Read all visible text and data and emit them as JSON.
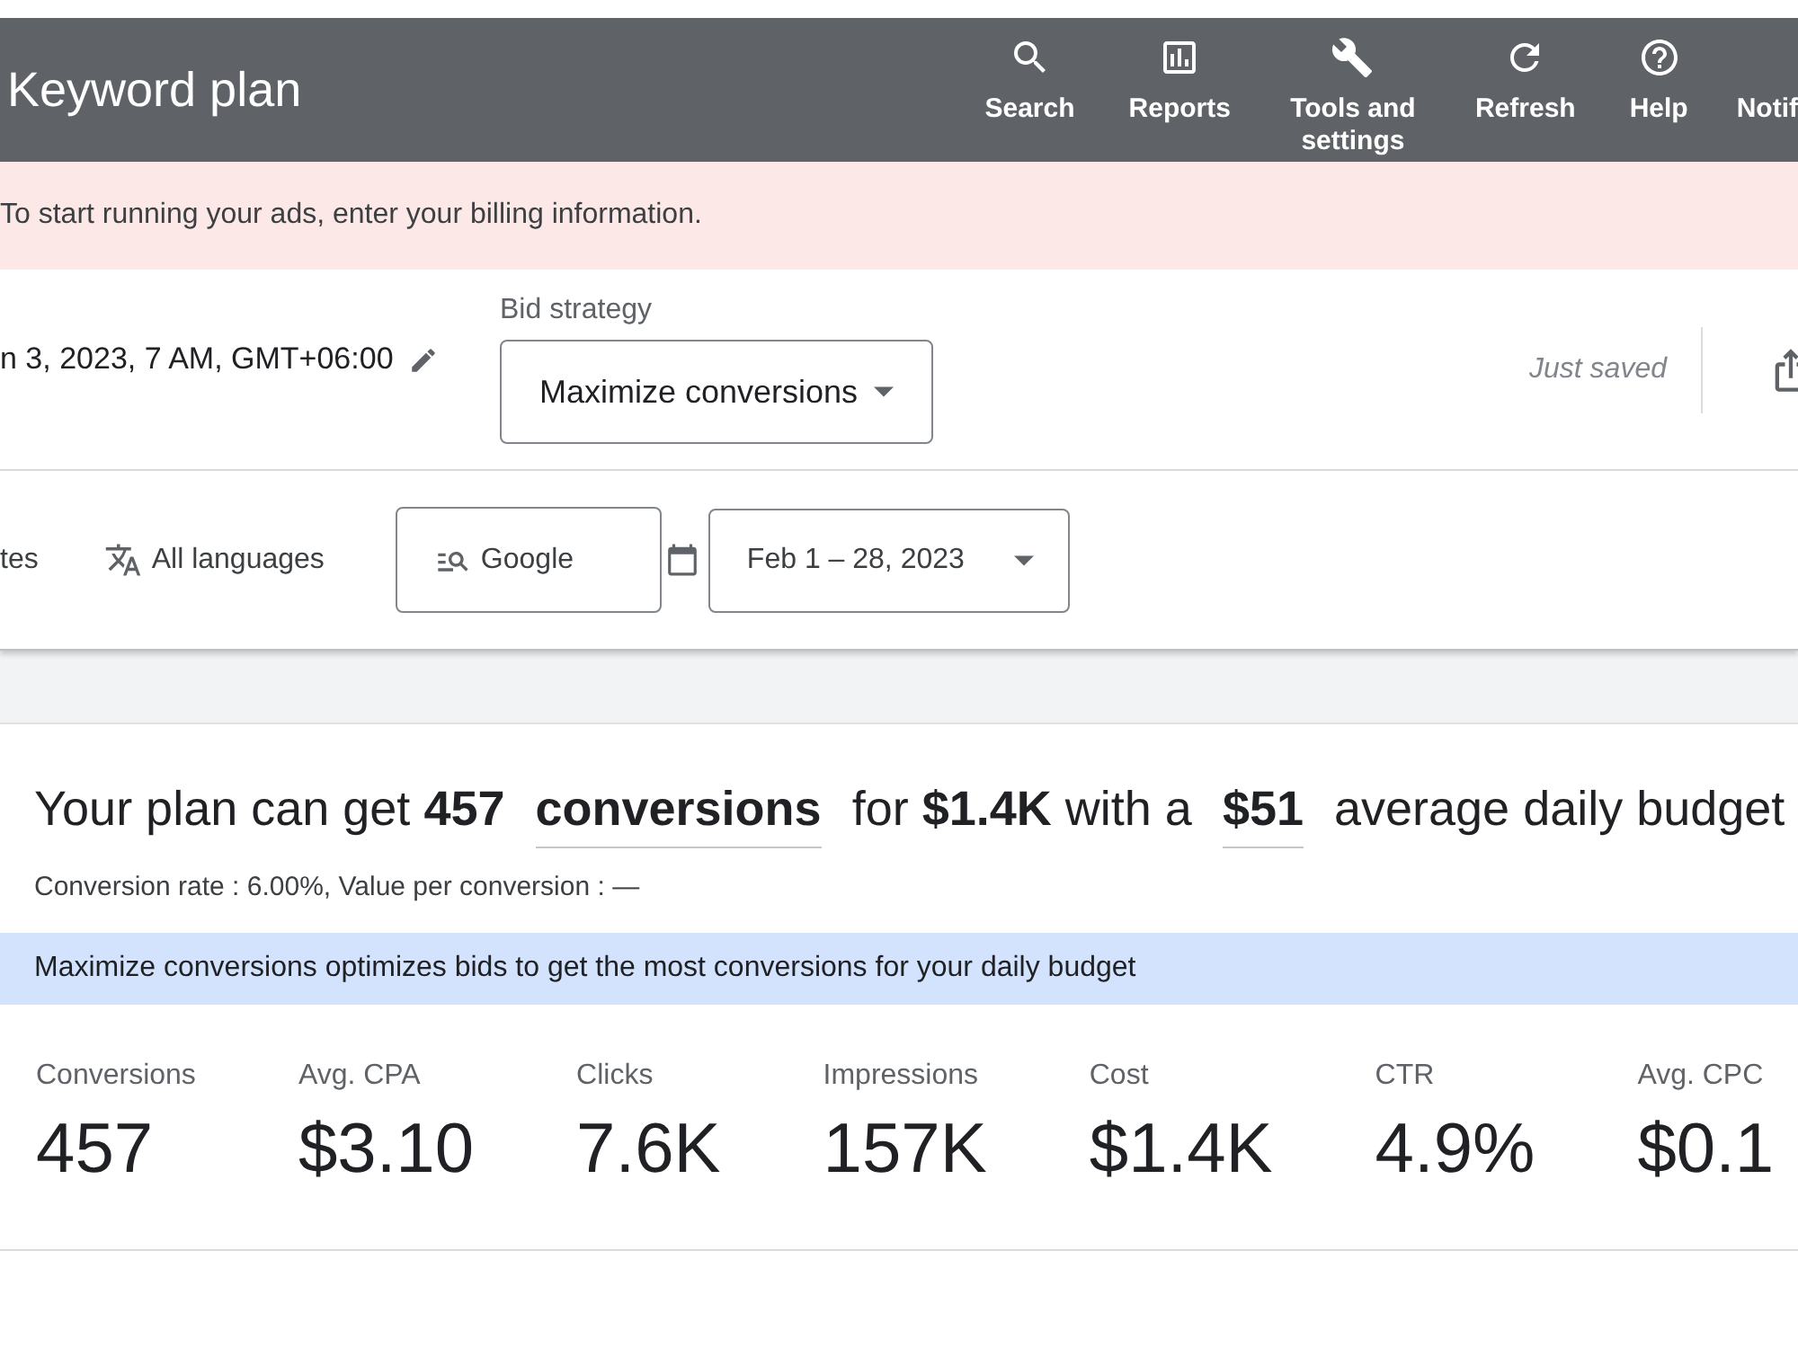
{
  "header": {
    "title": "Keyword plan",
    "actions": [
      {
        "kind": "search",
        "label": "Search"
      },
      {
        "kind": "reports",
        "label": "Reports"
      },
      {
        "kind": "tools",
        "label": "Tools and settings"
      },
      {
        "kind": "refresh",
        "label": "Refresh"
      },
      {
        "kind": "help",
        "label": "Help"
      },
      {
        "label": "Notif"
      }
    ]
  },
  "banner": {
    "text": "To start running your ads, enter your billing information."
  },
  "plan_bar": {
    "schedule": "n 3, 2023, 7 AM, GMT+06:00",
    "bid_strategy": {
      "label": "Bid strategy",
      "value": "Maximize conversions"
    },
    "save_status": "Just saved"
  },
  "filters": {
    "locations": "tes",
    "languages": "All languages",
    "network": "Google",
    "date_range": "Feb 1 – 28, 2023"
  },
  "forecast": {
    "headline": [
      {
        "kind": "text",
        "text": "Your plan can get **457**"
      },
      {
        "kind": "dropdown",
        "text": "conversions"
      },
      {
        "kind": "text",
        "text": "for **$1.4K** with a"
      },
      {
        "kind": "dropdown",
        "text": "$51"
      },
      {
        "kind": "text",
        "text": "average daily budget"
      }
    ],
    "details": "Conversion rate : 6.00%, Value per conversion : —",
    "info": "Maximize conversions optimizes bids to get the most conversions for your daily budget",
    "metrics": [
      {
        "label": "Conversions",
        "value": "457"
      },
      {
        "label": "Avg. CPA",
        "value": "$3.10"
      },
      {
        "label": "Clicks",
        "value": "7.6K"
      },
      {
        "label": "Impressions",
        "value": "157K"
      },
      {
        "label": "Cost",
        "value": "$1.4K"
      },
      {
        "label": "CTR",
        "value": "4.9%"
      },
      {
        "label": "Avg. CPC",
        "value": "$0.1"
      }
    ]
  }
}
